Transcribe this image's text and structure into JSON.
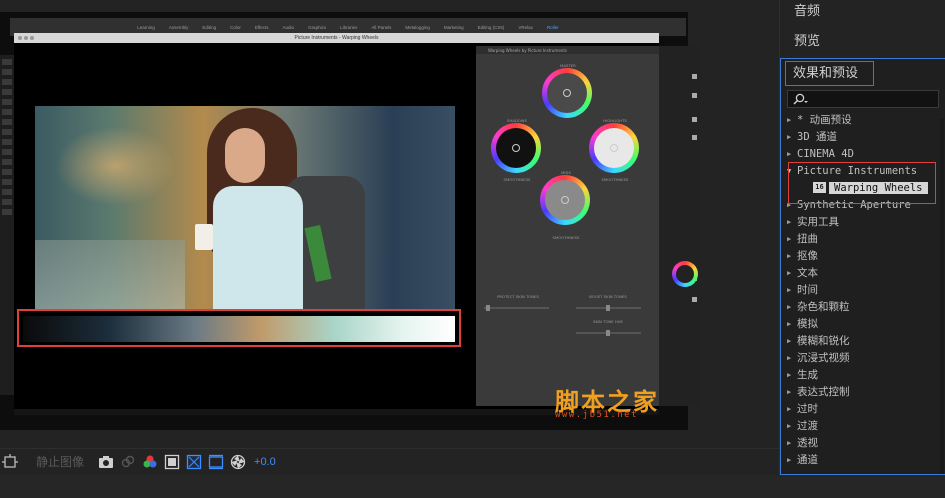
{
  "app_menu": {
    "items": [
      "Learning",
      "Assembly",
      "Editing",
      "Color",
      "Effects",
      "Audio",
      "Graphics",
      "Libraries",
      "All Panels",
      "Metalogging",
      "Marketing",
      "Editing (CS6)",
      "VRelax",
      "Roller"
    ],
    "active_index": 13
  },
  "plugin_window": {
    "title": "Picture Instruments - Warping Wheels",
    "panel_header": "Warping Wheels by Picture Instruments",
    "wheels": [
      {
        "label": "MASTER"
      },
      {
        "label": "SHADOWS"
      },
      {
        "label": "HIGHLIGHTS"
      },
      {
        "label": "MIDS"
      }
    ],
    "smoothness_label": "SMOOTHNESS",
    "sliders": [
      {
        "label": "PROTECT SKIN TONES"
      },
      {
        "label": "BOOST SKIN TONES"
      },
      {
        "label": "SKIN TONE HUE"
      }
    ]
  },
  "toolbar": {
    "still_image_label": "静止图像",
    "exposure_value": "+0.0",
    "icons": [
      "snapshot-icon",
      "camera-icon",
      "link-icon",
      "color-channels-icon",
      "safe-margins-icon",
      "transparency-grid-icon",
      "region-of-interest-icon",
      "reset-exposure-icon"
    ]
  },
  "right_panel": {
    "tabs": [
      {
        "label": "音频"
      },
      {
        "label": "预览"
      }
    ],
    "effects_title": "效果和预设",
    "search": {
      "placeholder": "",
      "value": ""
    },
    "effects": [
      {
        "label": "* 动画预设",
        "expanded": false
      },
      {
        "label": "3D 通道",
        "expanded": false
      },
      {
        "label": "CINEMA 4D",
        "expanded": false
      },
      {
        "label": "Picture Instruments",
        "expanded": true
      },
      {
        "label": "Warping Wheels",
        "child": true,
        "badge": "16",
        "selected": true
      },
      {
        "label": "Synthetic Aperture",
        "expanded": false
      },
      {
        "label": "实用工具",
        "expanded": false
      },
      {
        "label": "扭曲",
        "expanded": false
      },
      {
        "label": "抠像",
        "expanded": false
      },
      {
        "label": "文本",
        "expanded": false
      },
      {
        "label": "时间",
        "expanded": false
      },
      {
        "label": "杂色和颗粒",
        "expanded": false
      },
      {
        "label": "模拟",
        "expanded": false
      },
      {
        "label": "模糊和锐化",
        "expanded": false
      },
      {
        "label": "沉浸式视频",
        "expanded": false
      },
      {
        "label": "生成",
        "expanded": false
      },
      {
        "label": "表达式控制",
        "expanded": false
      },
      {
        "label": "过时",
        "expanded": false
      },
      {
        "label": "过渡",
        "expanded": false
      },
      {
        "label": "透视",
        "expanded": false
      },
      {
        "label": "通道",
        "expanded": false
      }
    ]
  },
  "watermark": {
    "title": "脚本之家",
    "url": "www.jb51.net"
  },
  "colors": {
    "accent_blue": "#3f8dff",
    "highlight_red": "#e0403a",
    "watermark_orange": "#f0a020"
  }
}
